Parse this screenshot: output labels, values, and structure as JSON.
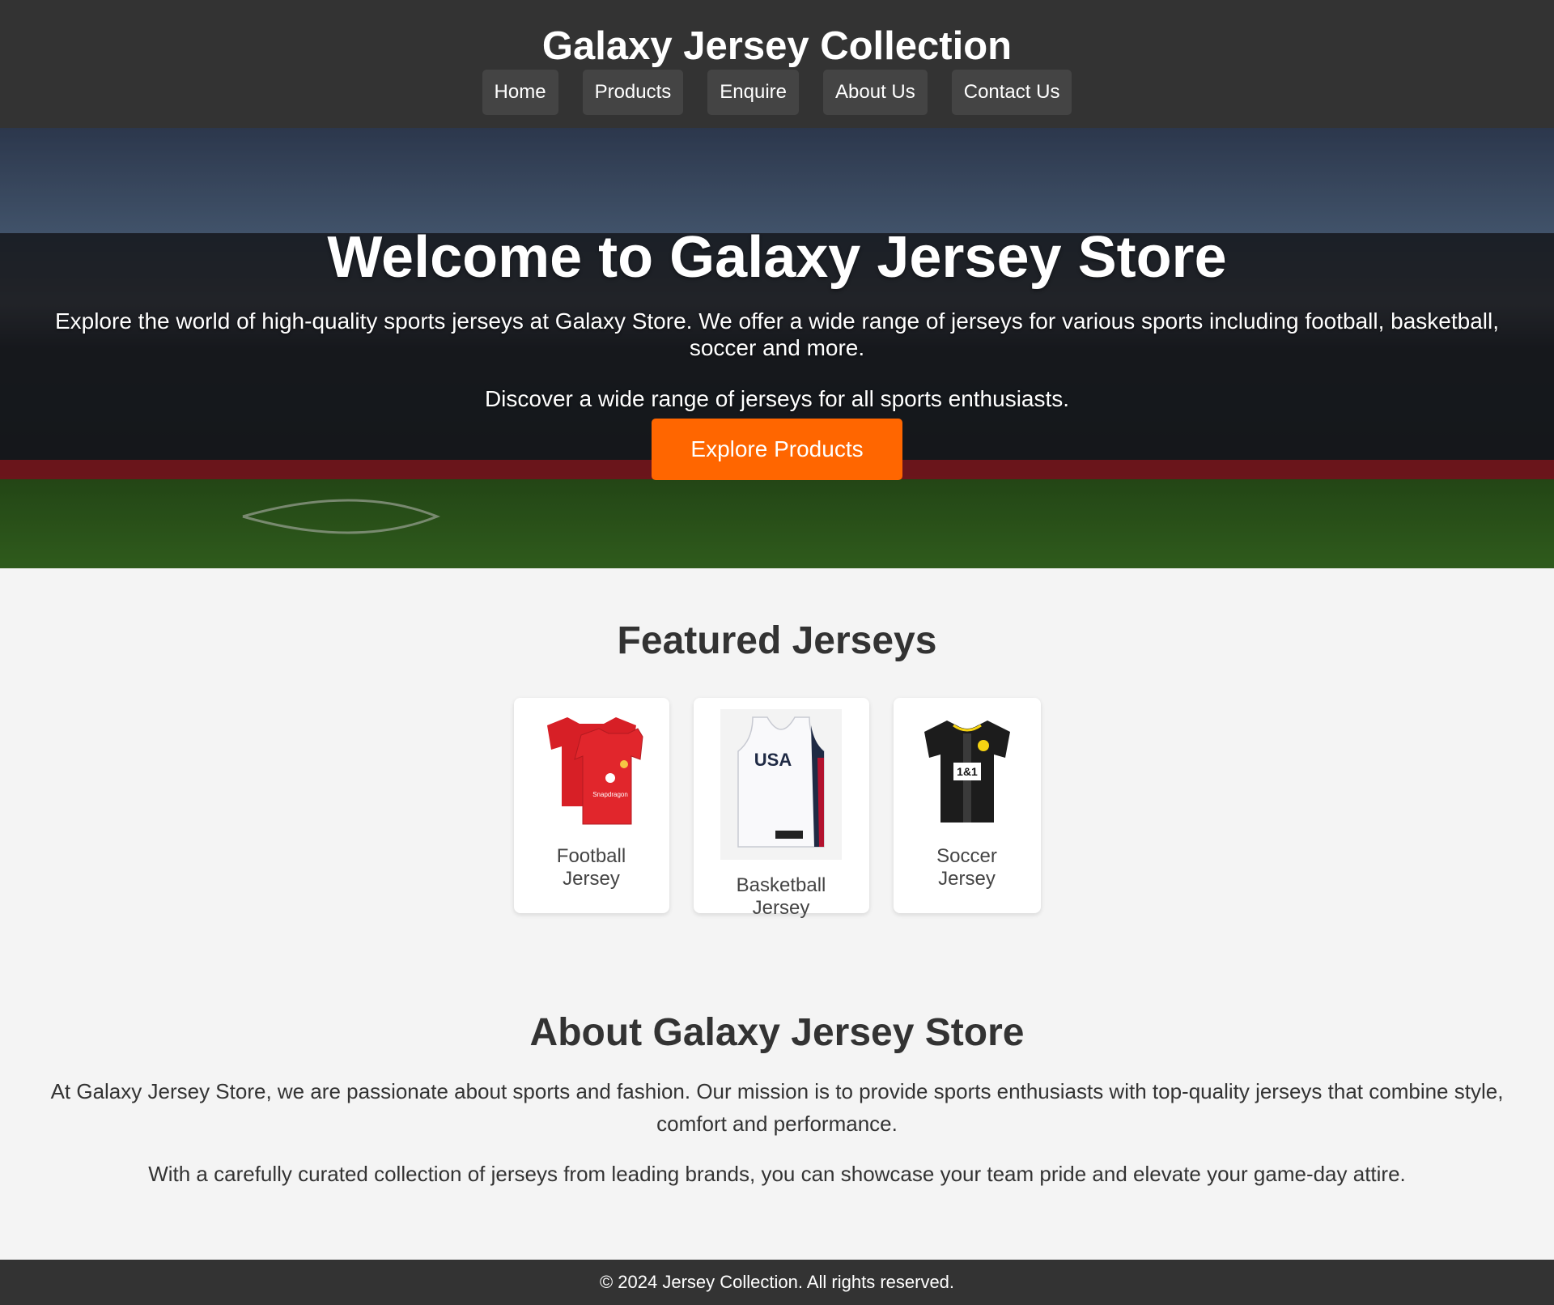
{
  "header": {
    "title": "Galaxy Jersey Collection",
    "nav": [
      "Home",
      "Products",
      "Enquire",
      "About Us",
      "Contact Us"
    ]
  },
  "hero": {
    "title": "Welcome to Galaxy Jersey Store",
    "description": "Explore the world of high-quality sports jerseys at Galaxy Store. We offer a wide range of jerseys for various sports including football, basketball, soccer and more.",
    "subtitle": "Discover a wide range of jerseys for all sports enthusiasts.",
    "button_label": "Explore Products"
  },
  "featured": {
    "title": "Featured Jerseys",
    "items": [
      {
        "label": "Football Jersey",
        "image": "red-football-jersey"
      },
      {
        "label": "Basketball Jersey",
        "image": "usa-basketball-jersey"
      },
      {
        "label": "Soccer Jersey",
        "image": "black-soccer-jersey"
      }
    ]
  },
  "about": {
    "title": "About Galaxy Jersey Store",
    "paragraphs": [
      "At Galaxy Jersey Store, we are passionate about sports and fashion. Our mission is to provide sports enthusiasts with top-quality jerseys that combine style, comfort and performance.",
      "With a carefully curated collection of jerseys from leading brands, you can showcase your team pride and elevate your game-day attire."
    ]
  },
  "footer": {
    "text": "© 2024 Jersey Collection. All rights reserved."
  },
  "colors": {
    "header_bg": "#333333",
    "nav_bg": "#444444",
    "accent": "#ff6600",
    "page_bg": "#f4f4f4"
  }
}
